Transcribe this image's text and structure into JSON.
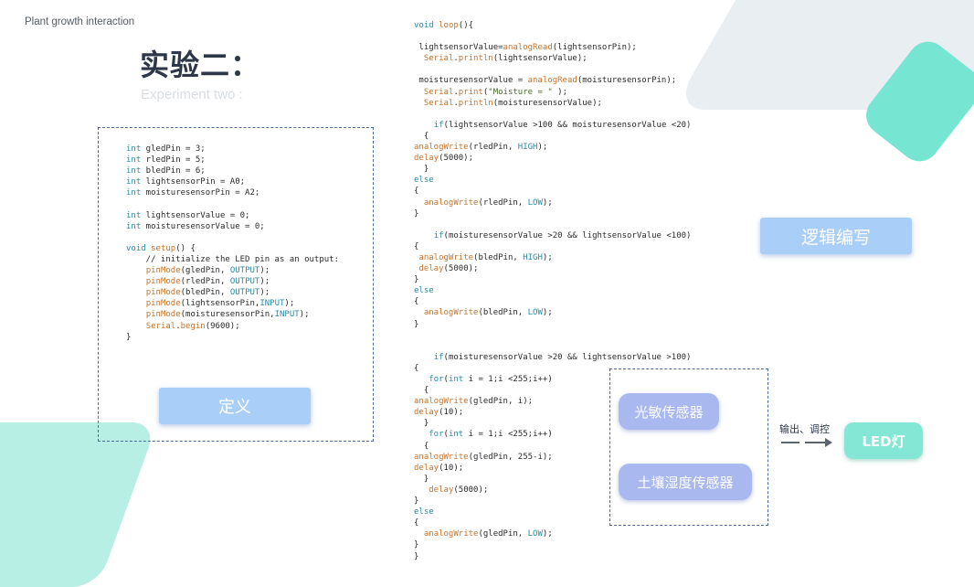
{
  "brand": "Plant growth interaction",
  "title_cn": "实验二：",
  "title_en": "Experiment two :",
  "definition_label": "定义",
  "logic_label": "逻辑编写",
  "sensors": [
    "光敏传感器",
    "土壤湿度传感器"
  ],
  "output_label": "输出、调控",
  "led_label": "LED灯",
  "colors": {
    "accent_blue": "#a9cff8",
    "pill_purple": "#a9b9f0",
    "teal": "#84e6d4",
    "dashed_border": "#4a6a9a"
  }
}
